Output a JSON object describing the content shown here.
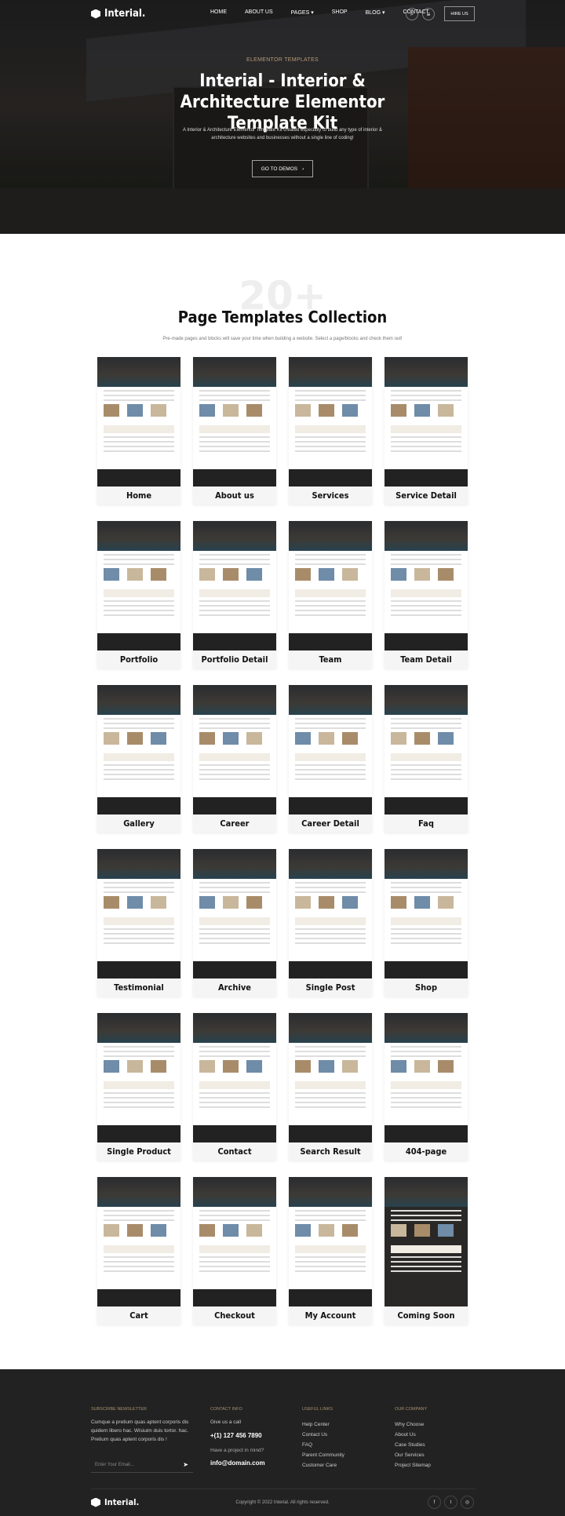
{
  "header": {
    "logo": "Interial.",
    "nav": [
      "HOME",
      "ABOUT US",
      "PAGES ▾",
      "SHOP",
      "BLOG ▾",
      "CONTACT"
    ],
    "hire_label": "HIRE US",
    "icons": [
      "search-icon",
      "menu-icon"
    ]
  },
  "hero": {
    "subtitle": "ELEMENTOR TEMPLATES",
    "title": "Interial - Interior & Architecture Elementor Template Kit",
    "description": "A Interior & Architecture Elementor Template Kit created especially to build any type of interior & architecture websites and businesses without a single line of coding!",
    "button": "GO TO DEMOS",
    "button_icon": "›"
  },
  "templates": {
    "big_number": "20+",
    "title": "Page Templates Collection",
    "description": "Pre-made pages and blocks will save your time when building a website. Select a page/blocks and check them out!",
    "items": [
      "Home",
      "About us",
      "Services",
      "Service Detail",
      "Portfolio",
      "Portfolio Detail",
      "Team",
      "Team Detail",
      "Gallery",
      "Career",
      "Career Detail",
      "Faq",
      "Testimonial",
      "Archive",
      "Single Post",
      "Shop",
      "Single Product",
      "Contact",
      "Search Result",
      "404-page",
      "Cart",
      "Checkout",
      "My Account",
      "Coming Soon"
    ]
  },
  "footer": {
    "newsletter": {
      "heading": "SUBSCRIBE NEWSLETTER",
      "text": "Cumque a pretium quas aptent corporis dis quidem libero hac. Wisiuim duis tortor. hac. Pretium quas aptent corporis dis !",
      "placeholder": "Enter Your Email..."
    },
    "contact": {
      "heading": "CONTACT INFO",
      "call_label": "Give us a call",
      "phone": "+(1) 127 456 7890",
      "project_label": "Have a project in mind?",
      "email": "info@domain.com"
    },
    "useful": {
      "heading": "USEFUL LINKS",
      "links": [
        "Help Center",
        "Contact Us",
        "FAQ",
        "Parent Community",
        "Customer Care"
      ]
    },
    "company": {
      "heading": "OUR COMPANY",
      "links": [
        "Why Choose",
        "About Us",
        "Case Studies",
        "Our Services",
        "Project Sitemap"
      ]
    },
    "logo": "Interial.",
    "copyright": "Copyright © 2022 Interial. All rights reserved.",
    "social": [
      "f",
      "t",
      "◎"
    ]
  },
  "colors": {
    "accent": "#a8906e",
    "dark": "#222222"
  }
}
